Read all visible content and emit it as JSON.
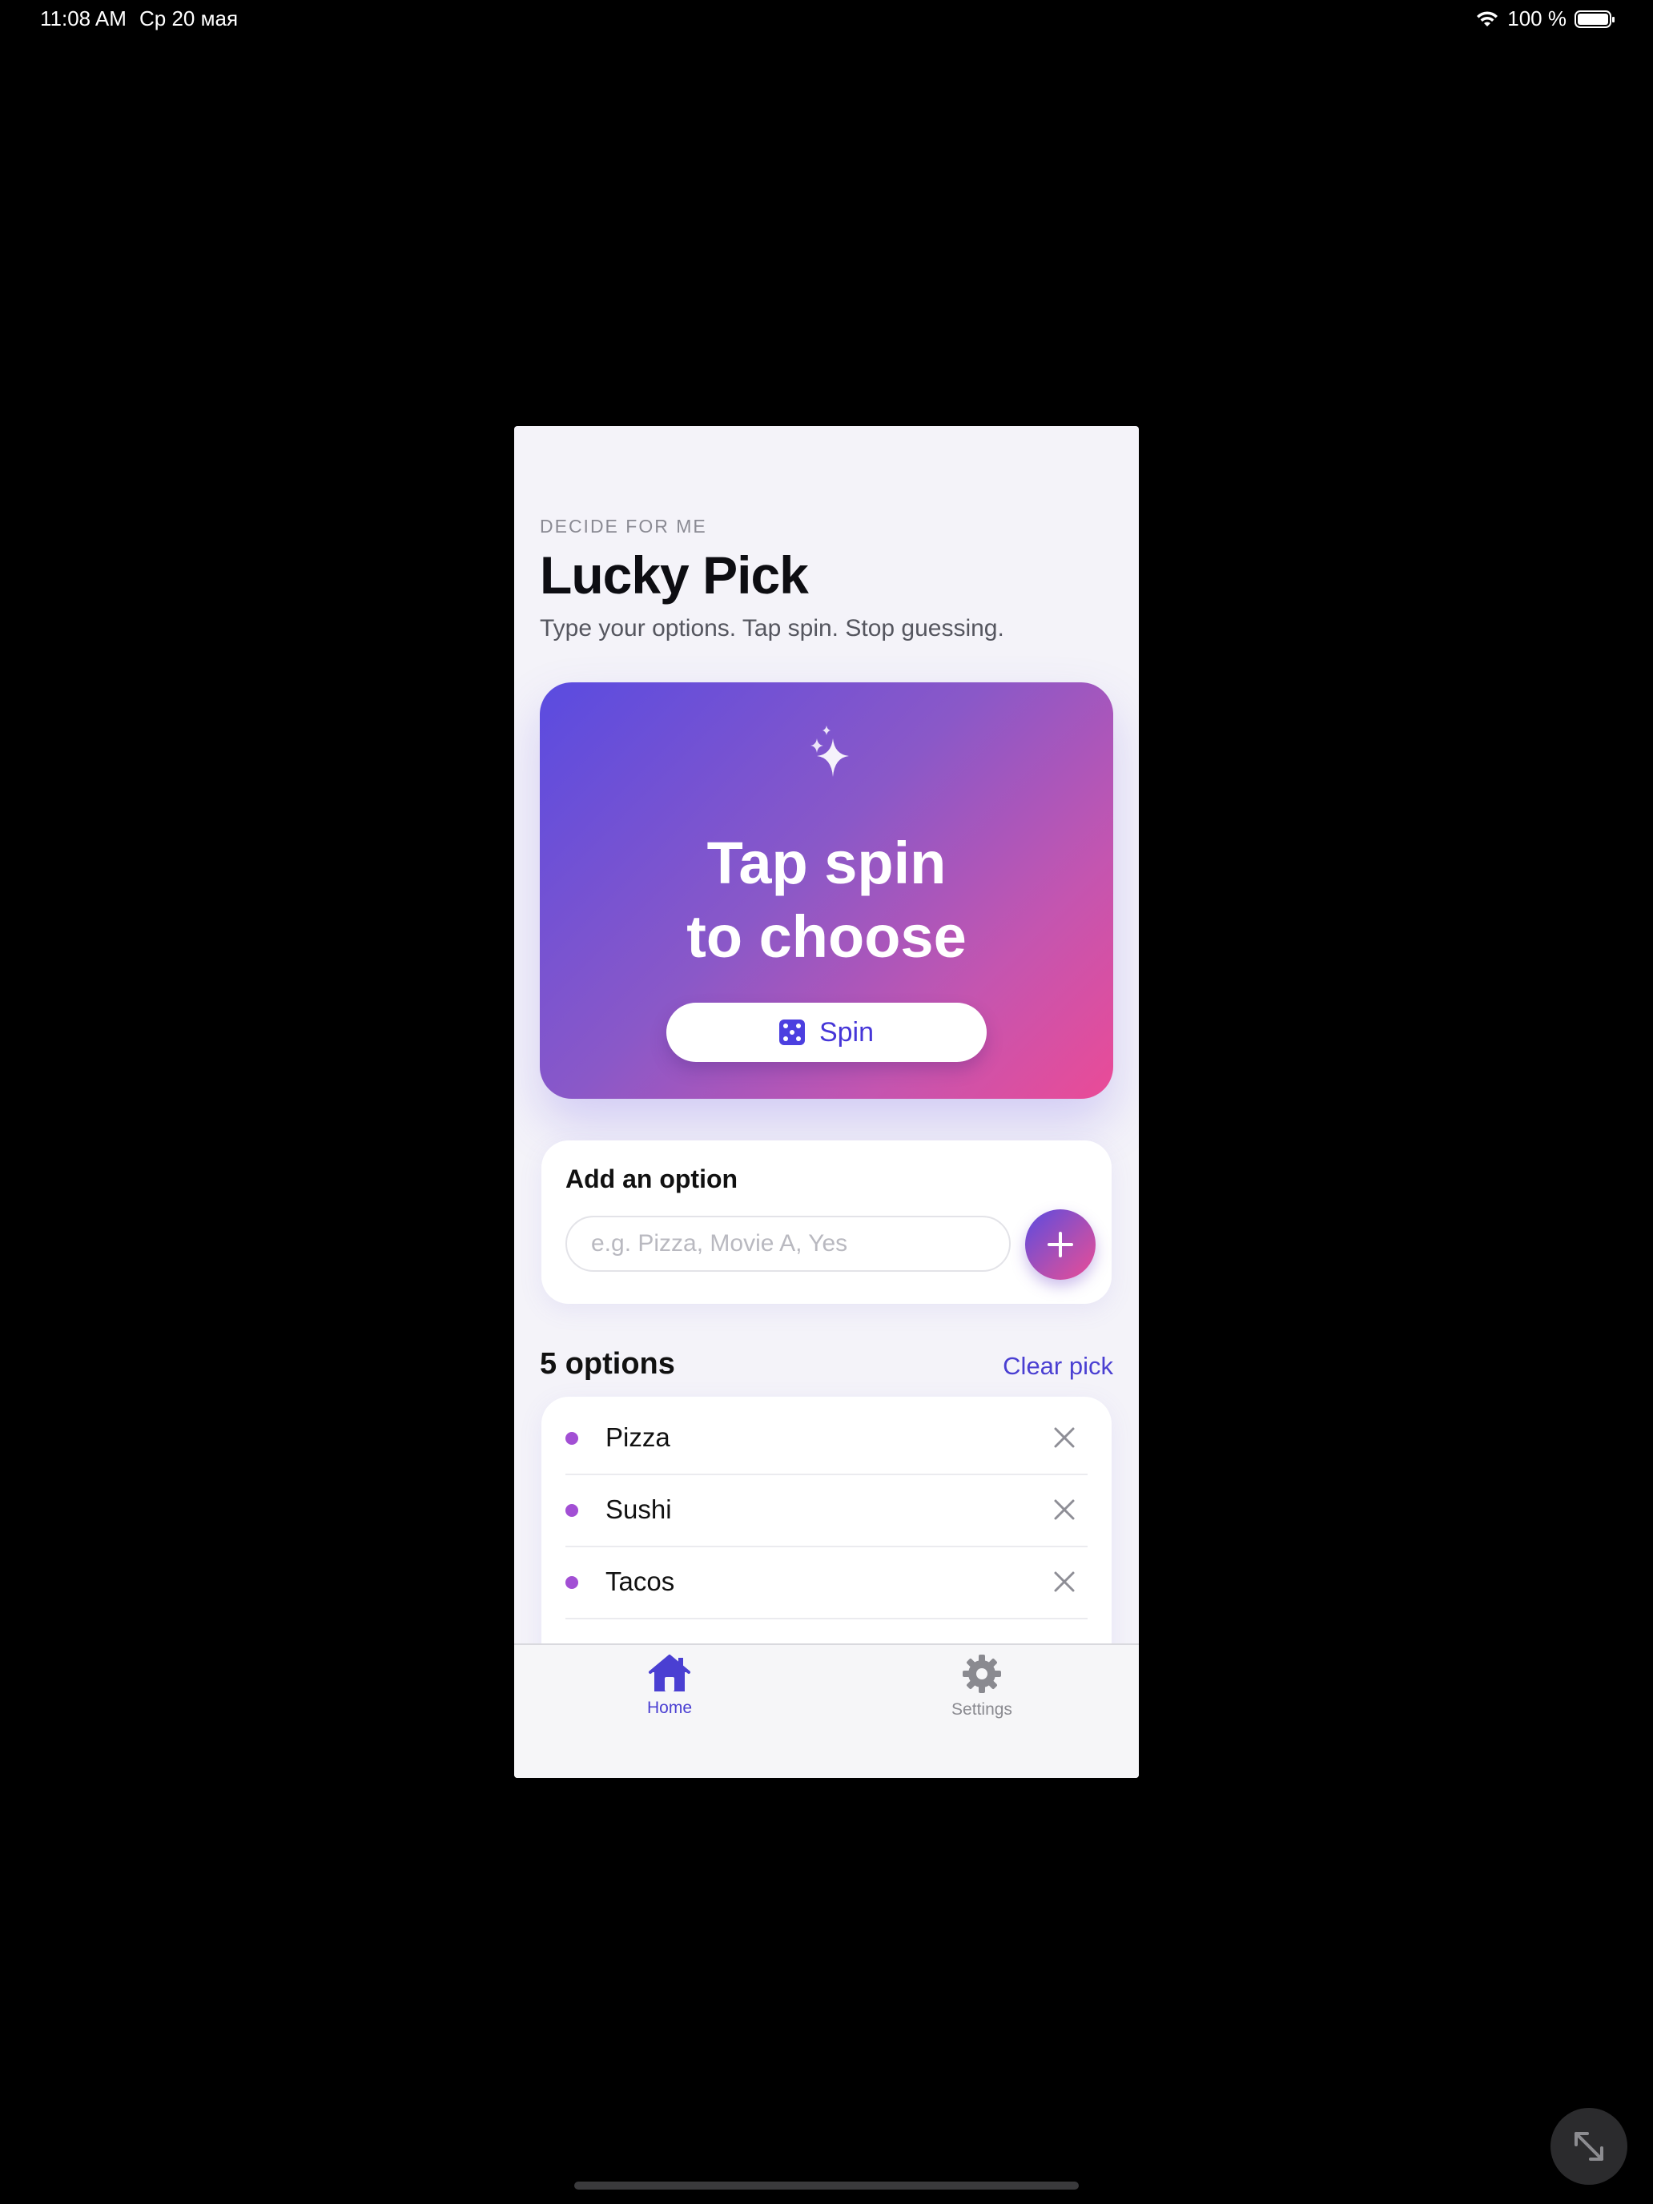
{
  "status_bar": {
    "time": "11:08 AM",
    "date": "Ср 20 мая",
    "battery": "100 %",
    "icons": [
      "wifi-icon",
      "battery-icon"
    ]
  },
  "header": {
    "eyebrow": "DECIDE FOR ME",
    "title": "Lucky Pick",
    "subtitle": "Type your options. Tap spin. Stop guessing."
  },
  "hero": {
    "icon": "sparkle-icon",
    "line1": "Tap spin",
    "line2": "to choose",
    "spin_label": "Spin",
    "spin_icon": "dice-icon"
  },
  "add_option": {
    "title": "Add an option",
    "placeholder": "e.g. Pizza, Movie A, Yes",
    "value": "",
    "button_icon": "plus-icon"
  },
  "options": {
    "count_label": "5 options",
    "clear_label": "Clear pick",
    "items": [
      {
        "label": "Pizza"
      },
      {
        "label": "Sushi"
      },
      {
        "label": "Tacos"
      }
    ]
  },
  "tab_bar": {
    "tabs": [
      {
        "label": "Home",
        "icon": "house-icon",
        "active": true
      },
      {
        "label": "Settings",
        "icon": "gear-icon",
        "active": false
      }
    ]
  },
  "colors": {
    "accent": "#4a3fd2",
    "gradient_start": "#5a4be0",
    "gradient_end": "#ea4b97",
    "option_dot": "#a24fd4",
    "background": "#f4f3f9"
  }
}
